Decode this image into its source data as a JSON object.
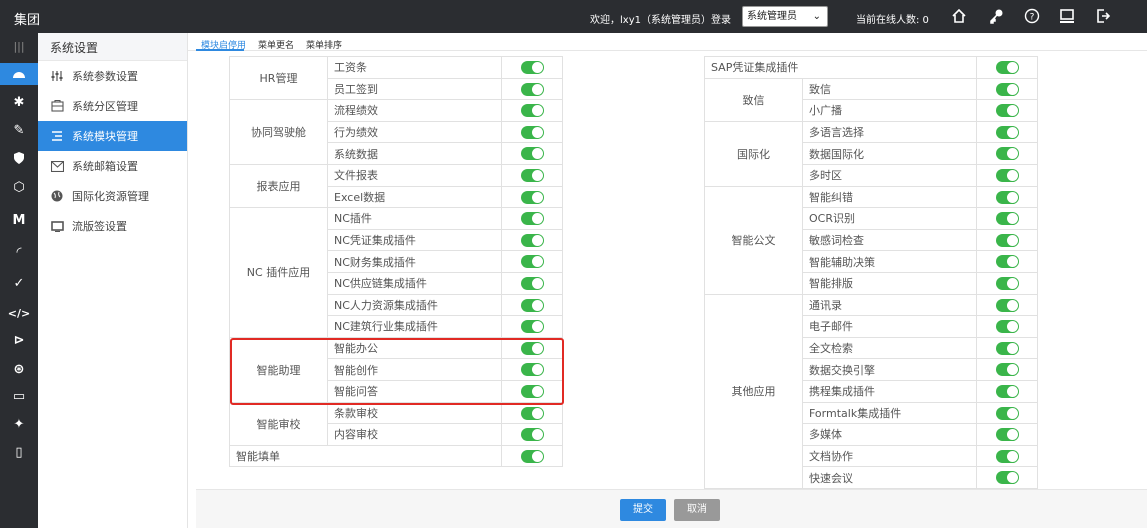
{
  "app": {
    "logo": "集团"
  },
  "topbar": {
    "welcome": "欢迎，lxy1（系统管理员）登录",
    "role": "系统管理员",
    "online": "当前在线人数: 0",
    "icons": [
      "home-icon",
      "key-icon",
      "help-icon",
      "monitor-icon",
      "logout-icon"
    ]
  },
  "sidebar": {
    "title": "系统设置",
    "items": [
      {
        "label": "系统参数设置",
        "icon": "sliders-icon"
      },
      {
        "label": "系统分区管理",
        "icon": "partition-icon"
      },
      {
        "label": "系统模块管理",
        "icon": "list-icon",
        "active": true
      },
      {
        "label": "系统邮箱设置",
        "icon": "mail-icon"
      },
      {
        "label": "国际化资源管理",
        "icon": "globe-icon"
      },
      {
        "label": "流版签设置",
        "icon": "screen-icon"
      }
    ]
  },
  "tabs": [
    "模块启停用",
    "菜单更名",
    "菜单排序"
  ],
  "left_table": [
    {
      "group": "HR管理",
      "items": [
        "工资条",
        "员工签到"
      ]
    },
    {
      "group": "协同驾驶舱",
      "items": [
        "流程绩效",
        "行为绩效",
        "系统数据"
      ]
    },
    {
      "group": "报表应用",
      "items": [
        "文件报表",
        "Excel数据"
      ]
    },
    {
      "group": "NC 插件应用",
      "items": [
        "NC插件",
        "NC凭证集成插件",
        "NC财务集成插件",
        "NC供应链集成插件",
        "NC人力资源集成插件",
        "NC建筑行业集成插件"
      ]
    },
    {
      "group": "智能助理",
      "items": [
        "智能办公",
        "智能创作",
        "智能问答"
      ]
    },
    {
      "group": "智能审校",
      "items": [
        "条款审校",
        "内容审校"
      ]
    },
    {
      "group": "智能填单",
      "items": []
    }
  ],
  "right_table": [
    {
      "group": "SAP凭证集成插件",
      "items": []
    },
    {
      "group": "致信",
      "items": [
        "致信",
        "小广播"
      ]
    },
    {
      "group": "国际化",
      "items": [
        "多语言选择",
        "数据国际化",
        "多时区"
      ]
    },
    {
      "group": "智能公文",
      "items": [
        "智能纠错",
        "OCR识别",
        "敏感词检查",
        "智能辅助决策",
        "智能排版"
      ]
    },
    {
      "group": "其他应用",
      "items": [
        "通讯录",
        "电子邮件",
        "全文检索",
        "数据交换引擎",
        "携程集成插件",
        "Formtalk集成插件",
        "多媒体",
        "文档协作",
        "快速会议"
      ]
    }
  ],
  "footer": {
    "submit": "提交",
    "cancel": "取消"
  }
}
